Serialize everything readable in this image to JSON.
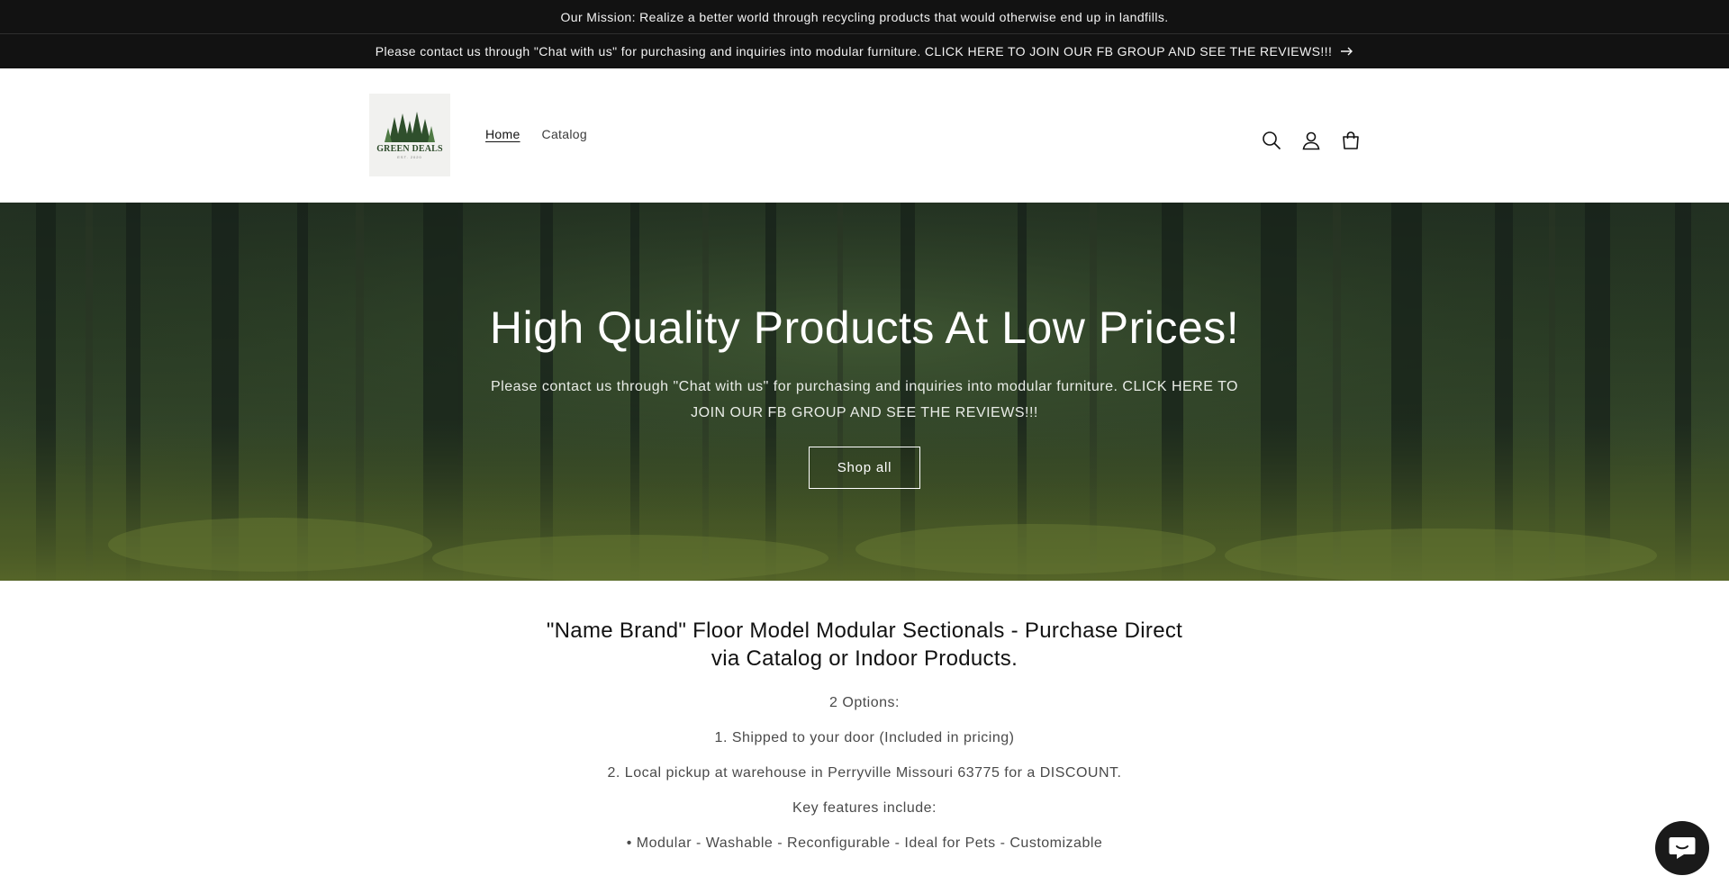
{
  "announcements": {
    "mission": "Our Mission: Realize a better world through recycling products that would otherwise end up in landfills.",
    "contact": "Please contact us through \"Chat with us\" for purchasing and inquiries into modular furniture. CLICK HERE TO JOIN OUR FB GROUP AND SEE THE REVIEWS!!!"
  },
  "header": {
    "logo_text": "GREEN DEALS",
    "logo_sub": "EST. 2020",
    "nav": [
      {
        "label": "Home",
        "active": true
      },
      {
        "label": "Catalog",
        "active": false
      }
    ],
    "icons": [
      "search-icon",
      "account-icon",
      "cart-icon"
    ]
  },
  "hero": {
    "title": "High Quality Products At Low Prices!",
    "subtitle": "Please contact us through \"Chat with us\" for purchasing and inquiries into modular furniture. CLICK HERE TO JOIN OUR FB GROUP AND SEE THE REVIEWS!!!",
    "button": "Shop all"
  },
  "rich_text": {
    "heading": "\"Name Brand\" Floor Model Modular Sectionals - Purchase Direct via Catalog or Indoor Products.",
    "lines": [
      "2 Options:",
      "1. Shipped to your door (Included in pricing)",
      "2. Local pickup at warehouse in Perryville Missouri 63775 for a DISCOUNT.",
      "Key features include:",
      "• Modular - Washable - Reconfigurable - Ideal for Pets - Customizable"
    ]
  },
  "chat": {
    "icon": "chat-icon"
  },
  "colors": {
    "bar": "#121212",
    "forest": "#2b3d26",
    "chat": "#1a1a1a"
  }
}
